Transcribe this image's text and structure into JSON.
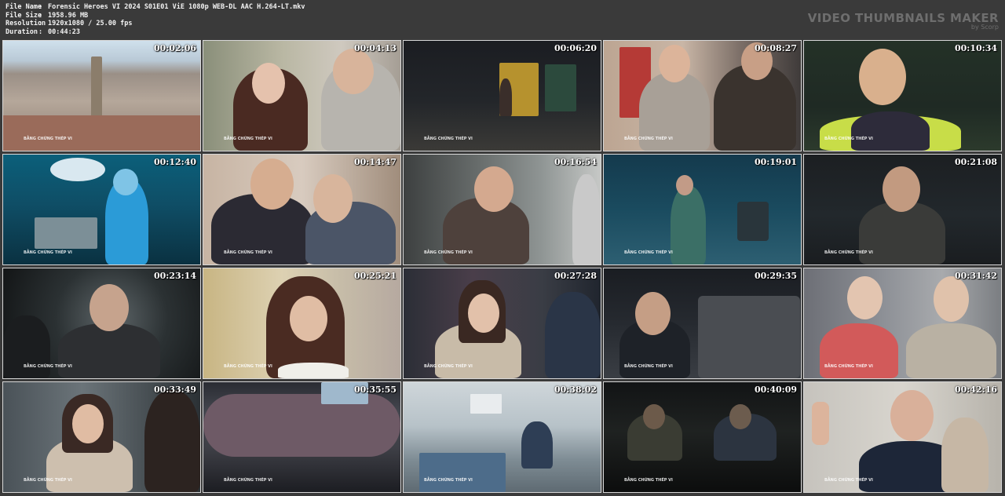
{
  "file_info": {
    "rows": [
      {
        "key": "File Name",
        "value": "Forensic Heroes VI 2024 S01E01 ViE 1080p WEB-DL AAC H.264-LT.mkv"
      },
      {
        "key": "File Size",
        "value": "1958.96 MB"
      },
      {
        "key": "Resolution",
        "value": "1920x1080 / 25.00 fps"
      },
      {
        "key": "Duration",
        "value": "00:44:23"
      }
    ],
    "separator": ":"
  },
  "brand": {
    "title": "VIDEO THUMBNAILS MAKER",
    "subtitle": "by Scorp"
  },
  "watermark": "BẰNG CHỨNG THÉP VI",
  "thumbnails": [
    {
      "timestamp": "00:02:06",
      "scene": "city-aerial"
    },
    {
      "timestamp": "00:04:13",
      "scene": "couple-embrace"
    },
    {
      "timestamp": "00:06:20",
      "scene": "night-street"
    },
    {
      "timestamp": "00:08:27",
      "scene": "two-men-street"
    },
    {
      "timestamp": "00:10:34",
      "scene": "man-vest"
    },
    {
      "timestamp": "00:12:40",
      "scene": "lab-blue"
    },
    {
      "timestamp": "00:14:47",
      "scene": "two-men-office"
    },
    {
      "timestamp": "00:16:54",
      "scene": "man-office"
    },
    {
      "timestamp": "00:19:01",
      "scene": "alley-blue"
    },
    {
      "timestamp": "00:21:08",
      "scene": "man-dark"
    },
    {
      "timestamp": "00:23:14",
      "scene": "suit-man-dark"
    },
    {
      "timestamp": "00:25:21",
      "scene": "woman-phone"
    },
    {
      "timestamp": "00:27:28",
      "scene": "woman-talking"
    },
    {
      "timestamp": "00:29:35",
      "scene": "man-car"
    },
    {
      "timestamp": "00:31:42",
      "scene": "two-women-street"
    },
    {
      "timestamp": "00:33:49",
      "scene": "woman-office"
    },
    {
      "timestamp": "00:35:55",
      "scene": "arm-closeup"
    },
    {
      "timestamp": "00:38:02",
      "scene": "morgue-lab"
    },
    {
      "timestamp": "00:40:09",
      "scene": "dark-reflection"
    },
    {
      "timestamp": "00:42:16",
      "scene": "man-pointing"
    }
  ]
}
